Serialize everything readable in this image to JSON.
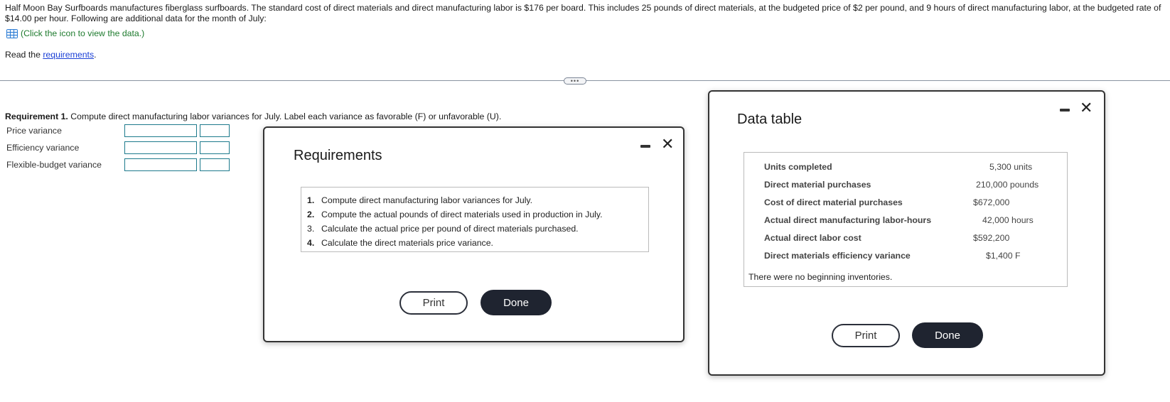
{
  "problem": {
    "intro_text": "Half Moon Bay Surfboards manufactures fiberglass surfboards. The standard cost of direct materials and direct manufacturing labor is $176 per board. This includes 25 pounds of direct materials, at the budgeted price of $2 per pound, and 9 hours of direct manufacturing labor, at the budgeted rate of $14.00 per hour. Following are additional data for the month of July:",
    "data_link_icon": "table-grid-icon",
    "data_link_text": "(Click the icon to view the data.)",
    "read_prefix": "Read the ",
    "read_link": "requirements",
    "read_suffix": ".",
    "expander_label": "…"
  },
  "requirement1": {
    "label": "Requirement 1.",
    "text": " Compute direct manufacturing labor variances for July. Label each variance as favorable (F) or unfavorable (U).",
    "rows": [
      {
        "label": "Price variance",
        "amount": "",
        "fu": ""
      },
      {
        "label": "Efficiency variance",
        "amount": "",
        "fu": ""
      },
      {
        "label": "Flexible-budget variance",
        "amount": "",
        "fu": ""
      }
    ]
  },
  "requirements_modal": {
    "title": "Requirements",
    "items": [
      {
        "num": "1.",
        "text": "Compute direct manufacturing labor variances for July."
      },
      {
        "num": "2.",
        "text": "Compute the actual pounds of direct materials used in production in July."
      },
      {
        "num": "3.",
        "text": "Calculate the actual price per pound of direct materials purchased."
      },
      {
        "num": "4.",
        "text": "Calculate the direct materials price variance."
      }
    ],
    "print_label": "Print",
    "done_label": "Done",
    "minimize_icon": "minimize-icon",
    "close_icon": "✕"
  },
  "data_modal": {
    "title": "Data table",
    "rows": [
      {
        "label": "Units completed",
        "value": "5,300 units"
      },
      {
        "label": "Direct material purchases",
        "value": "210,000 pounds"
      },
      {
        "label": "Cost of direct material purchases",
        "value": "$672,000"
      },
      {
        "label": "Actual direct manufacturing labor-hours",
        "value": "42,000 hours"
      },
      {
        "label": "Actual direct labor cost",
        "value": "$592,200"
      },
      {
        "label": "Direct materials efficiency variance",
        "value": "$1,400 F"
      }
    ],
    "note": "There were no beginning inventories.",
    "print_label": "Print",
    "done_label": "Done",
    "minimize_icon": "minimize-icon",
    "close_icon": "✕"
  }
}
